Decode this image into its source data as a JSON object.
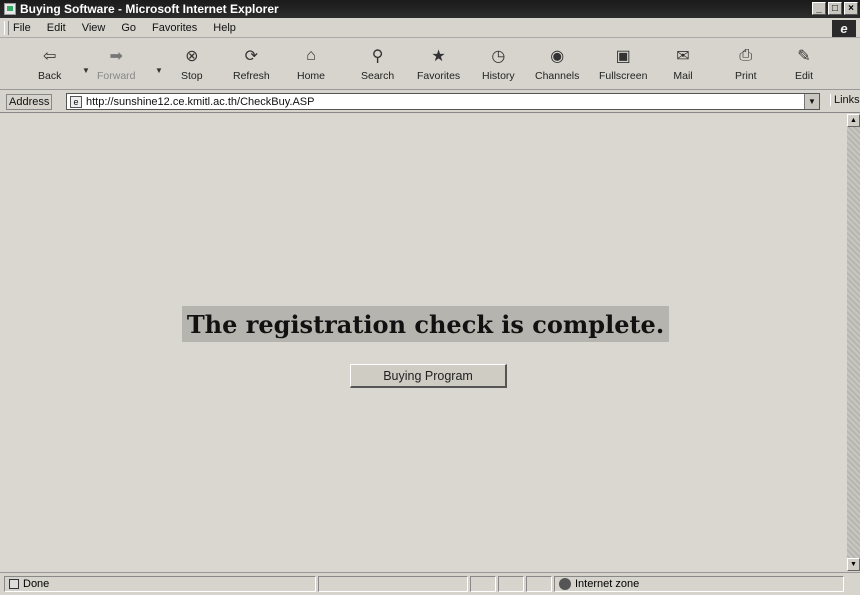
{
  "window": {
    "title": "Buying Software - Microsoft Internet Explorer"
  },
  "menu": [
    "File",
    "Edit",
    "View",
    "Go",
    "Favorites",
    "Help"
  ],
  "toolbar": {
    "back": "Back",
    "forward": "Forward",
    "stop": "Stop",
    "refresh": "Refresh",
    "home": "Home",
    "search": "Search",
    "favorites": "Favorites",
    "history": "History",
    "channels": "Channels",
    "fullscreen": "Fullscreen",
    "mail": "Mail",
    "print": "Print",
    "edit": "Edit"
  },
  "address": {
    "label": "Address",
    "url": "http://sunshine12.ce.kmitl.ac.th/CheckBuy.ASP",
    "links": "Links"
  },
  "page": {
    "message": "The registration check is complete.",
    "button": "Buying Program"
  },
  "status": {
    "text": "Done",
    "zone": "Internet zone"
  }
}
